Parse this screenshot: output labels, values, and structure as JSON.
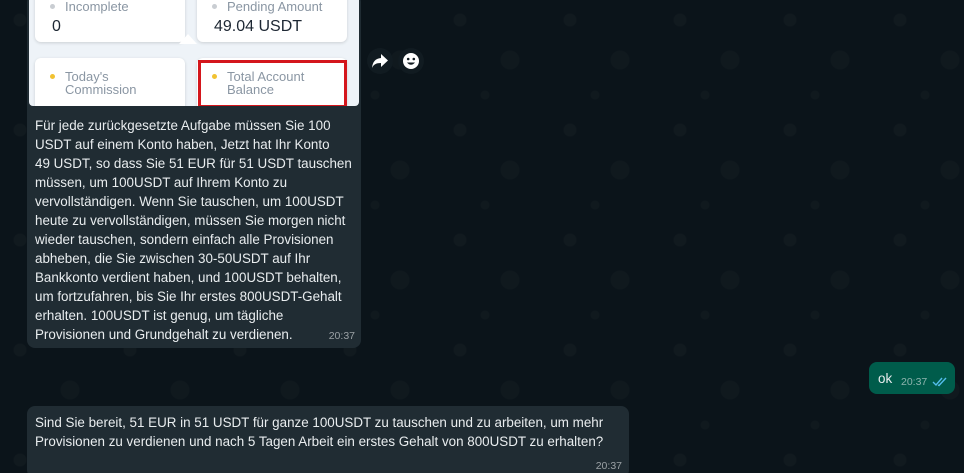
{
  "preview": {
    "cards": [
      {
        "label": "Incomplete",
        "value": "0",
        "dot": "#c9cdd2"
      },
      {
        "label": "Pending Amount",
        "value": "49.04 USDT",
        "dot": "#c9cdd2"
      },
      {
        "label": "Today's\nCommission",
        "value": "",
        "dot": "#f1c232"
      },
      {
        "label": "Total Account\nBalance",
        "value": "",
        "dot": "#f1c232"
      }
    ],
    "highlight_color": "#d4161c"
  },
  "messages": [
    {
      "direction": "incoming",
      "text": "Für jede zurückgesetzte Aufgabe müssen Sie 100\nUSDT auf einem Konto haben, Jetzt hat Ihr Konto\n49 USDT, so dass Sie 51 EUR für 51 USDT tauschen\nmüssen, um 100USDT auf Ihrem Konto zu\nvervollständigen. Wenn Sie tauschen, um 100USDT\nheute zu vervollständigen, müssen Sie morgen nicht\nwieder tauschen, sondern einfach alle Provisionen\nabheben, die Sie zwischen 30-50USDT auf Ihr\nBankkonto verdient haben, und 100USDT behalten,\num fortzufahren, bis Sie Ihr erstes 800USDT-Gehalt\nerhalten. 100USDT ist genug, um tägliche\nProvisionen und Grundgehalt zu verdienen.",
      "time": "20:37"
    },
    {
      "direction": "outgoing",
      "text": "ok",
      "time": "20:37"
    },
    {
      "direction": "incoming",
      "text": "Sind Sie bereit, 51 EUR in 51 USDT für ganze 100USDT zu tauschen und zu arbeiten, um mehr\nProvisionen zu verdienen und nach 5 Tagen Arbeit ein erstes Gehalt von 800USDT zu erhalten?",
      "time": "20:37"
    }
  ],
  "colors": {
    "background": "#0b141a",
    "incoming_bubble": "#202c33",
    "outgoing_bubble": "#005c4b",
    "read_ticks": "#53bdeb"
  },
  "icons": {
    "forward": "forward-icon",
    "emoji": "emoji-icon",
    "read_receipt": "double-check-icon"
  }
}
